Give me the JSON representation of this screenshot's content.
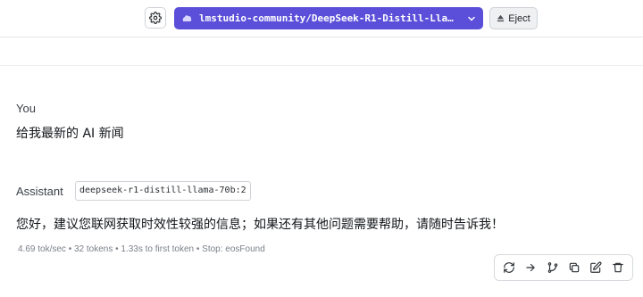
{
  "toolbar": {
    "model_label": "lmstudio-community/DeepSeek-R1-Distill-Llama-70B…",
    "eject_label": "Eject"
  },
  "conversation": {
    "user": {
      "role": "You",
      "text": "给我最新的 AI 新闻"
    },
    "assistant": {
      "role": "Assistant",
      "model_tag": "deepseek-r1-distill-llama-70b:2",
      "text": "您好，建议您联网获取时效性较强的信息；如果还有其他问题需要帮助，请随时告诉我！",
      "stats": "4.69 tok/sec  •  32 tokens  •  1.33s to first token  •  Stop: eosFound"
    }
  },
  "message_actions": [
    "regenerate-icon",
    "continue-icon",
    "branch-icon",
    "copy-icon",
    "edit-icon",
    "delete-icon"
  ],
  "colors": {
    "accent": "#5b4fd9"
  }
}
